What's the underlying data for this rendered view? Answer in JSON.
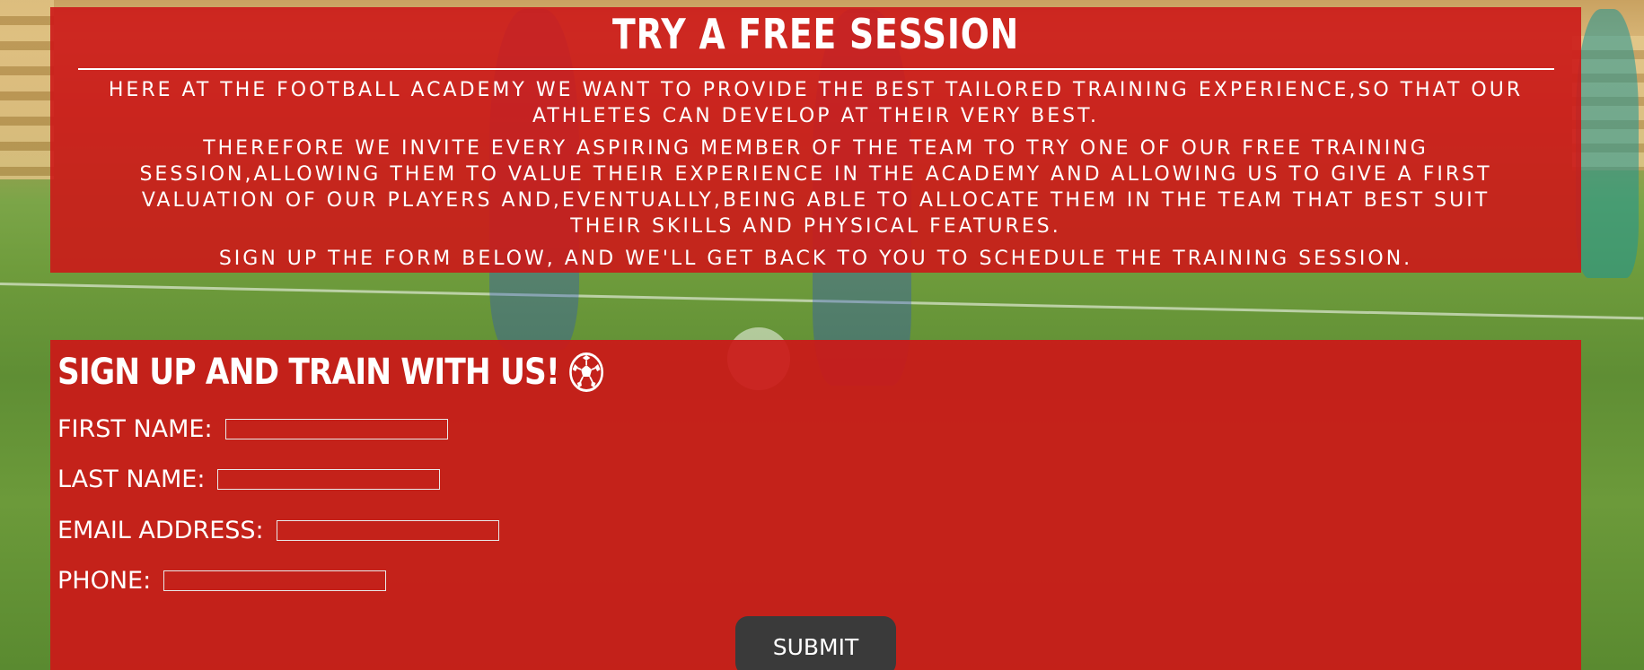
{
  "intro": {
    "title": "TRY A FREE SESSION",
    "paragraphs": [
      "HERE AT THE FOOTBALL ACADEMY WE WANT TO PROVIDE THE BEST TAILORED TRAINING EXPERIENCE,SO THAT OUR ATHLETES CAN DEVELOP AT THEIR VERY BEST.",
      "THEREFORE WE INVITE EVERY ASPIRING MEMBER OF THE TEAM TO TRY ONE OF OUR FREE TRAINING SESSION,ALLOWING THEM TO VALUE THEIR EXPERIENCE IN THE ACADEMY AND ALLOWING US TO GIVE A FIRST VALUATION OF OUR PLAYERS AND,EVENTUALLY,BEING ABLE TO ALLOCATE THEM IN THE TEAM THAT BEST SUIT THEIR SKILLS AND PHYSICAL FEATURES.",
      "SIGN UP THE FORM BELOW, AND WE'LL GET BACK TO YOU TO SCHEDULE THE TRAINING SESSION."
    ]
  },
  "form": {
    "title": "SIGN UP AND TRAIN WITH US!",
    "title_icon": "soccer-ball-icon",
    "fields": [
      {
        "label": "FIRST NAME:",
        "value": ""
      },
      {
        "label": "LAST NAME:",
        "value": ""
      },
      {
        "label": "EMAIL ADDRESS:",
        "value": ""
      },
      {
        "label": "PHONE:",
        "value": ""
      }
    ],
    "submit_label": "SUBMIT"
  },
  "colors": {
    "panel": "#cc1818",
    "text": "#ffffff",
    "button": "#3a3a3a"
  }
}
